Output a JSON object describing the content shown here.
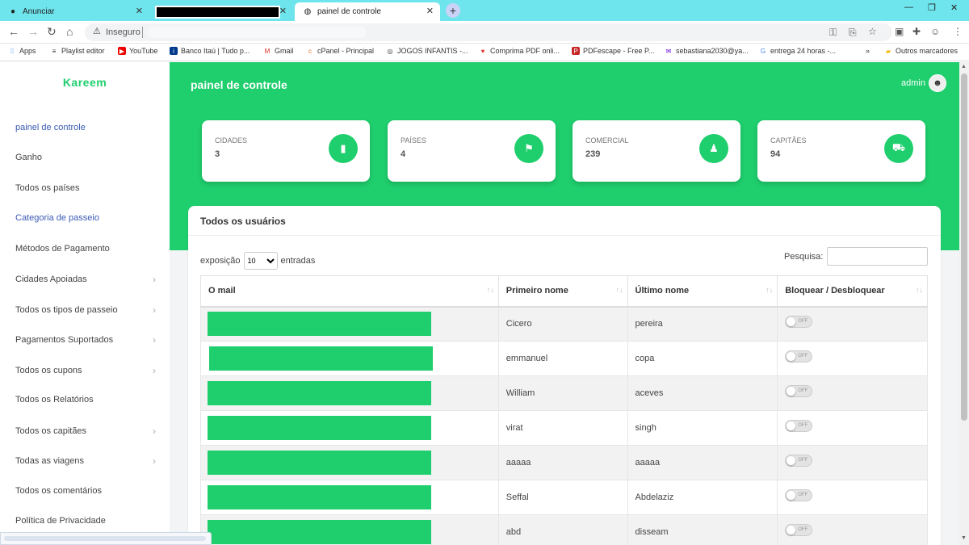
{
  "browser": {
    "tabs": [
      {
        "title": "Anunciar"
      },
      {
        "title": ""
      },
      {
        "title": "painel de controle"
      }
    ],
    "omnibox": {
      "security_label": "Inseguro"
    },
    "bookmarks": [
      {
        "label": "Apps"
      },
      {
        "label": "Playlist editor"
      },
      {
        "label": "YouTube"
      },
      {
        "label": "Banco Itaú | Tudo p..."
      },
      {
        "label": "Gmail"
      },
      {
        "label": "cPanel - Principal"
      },
      {
        "label": "JOGOS INFANTIS -..."
      },
      {
        "label": "Comprima PDF onli..."
      },
      {
        "label": "PDFescape - Free P..."
      },
      {
        "label": "sebastiana2030@ya..."
      },
      {
        "label": "entrega 24 horas -..."
      },
      {
        "label": "»"
      },
      {
        "label": "Outros marcadores"
      }
    ]
  },
  "sidebar": {
    "brand": "Kareem",
    "items": [
      {
        "label": "painel de controle",
        "chevron": false
      },
      {
        "label": "Ganho",
        "chevron": false
      },
      {
        "label": "Todos os países",
        "chevron": false
      },
      {
        "label": "Categoria de passeio",
        "chevron": false
      },
      {
        "label": "Métodos de Pagamento",
        "chevron": false
      },
      {
        "label": "Cidades Apoiadas",
        "chevron": true
      },
      {
        "label": "Todos os tipos de passeio",
        "chevron": true
      },
      {
        "label": "Pagamentos Suportados",
        "chevron": true
      },
      {
        "label": "Todos os cupons",
        "chevron": true
      },
      {
        "label": "Todos os Relatórios",
        "chevron": false
      },
      {
        "label": "Todos os capitães",
        "chevron": true
      },
      {
        "label": "Todas as viagens",
        "chevron": true
      },
      {
        "label": "Todos os comentários",
        "chevron": false
      },
      {
        "label": "Política de Privacidade",
        "chevron": false
      }
    ]
  },
  "header": {
    "title": "painel de controle",
    "user": "admin"
  },
  "stats": [
    {
      "label": "CIDADES",
      "value": "3",
      "icon": "building-icon"
    },
    {
      "label": "PAÍSES",
      "value": "4",
      "icon": "flag-icon"
    },
    {
      "label": "COMERCIAL",
      "value": "239",
      "icon": "users-icon"
    },
    {
      "label": "CAPITÃES",
      "value": "94",
      "icon": "car-icon"
    }
  ],
  "users_table": {
    "title": "Todos os usuários",
    "length_prefix": "exposição",
    "length_value": "10",
    "length_suffix": "entradas",
    "search_label": "Pesquisa:",
    "columns": [
      "O mail",
      "Primeiro nome",
      "Último nome",
      "Bloquear / Desbloquear"
    ],
    "toggle_label": "OFF",
    "rows": [
      {
        "first": "Cicero",
        "last": "pereira"
      },
      {
        "first": "emmanuel",
        "last": "copa"
      },
      {
        "first": "William",
        "last": "aceves"
      },
      {
        "first": "virat",
        "last": "singh"
      },
      {
        "first": "aaaaa",
        "last": "aaaaa"
      },
      {
        "first": "Seffal",
        "last": "Abdelaziz"
      },
      {
        "first": "abd",
        "last": "disseam"
      }
    ]
  },
  "colors": {
    "accent": "#1fce6d",
    "tabbar": "#6ee4ec",
    "link": "#3b5bb5"
  }
}
